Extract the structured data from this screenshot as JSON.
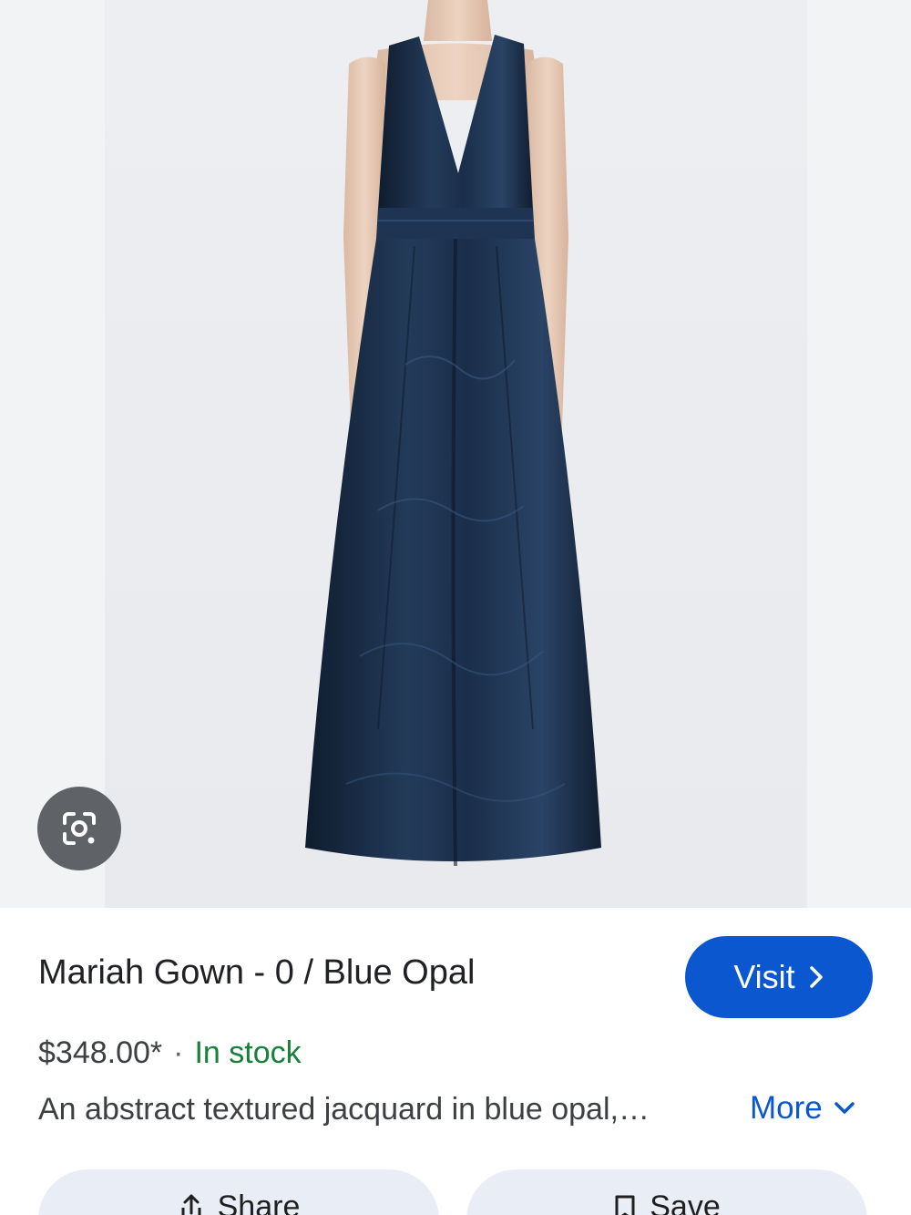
{
  "product": {
    "title": "Mariah Gown - 0 / Blue Opal",
    "price": "$348.00*",
    "separator": "·",
    "availability": "In stock",
    "description": "An abstract textured jacquard in blue opal,…"
  },
  "actions": {
    "visit_label": "Visit",
    "more_label": "More",
    "share_label": "Share",
    "save_label": "Save"
  },
  "icons": {
    "lens": "google-lens-icon",
    "visit_chevron": "chevron-right-icon",
    "more_chevron": "chevron-down-icon",
    "share": "share-icon",
    "save": "bookmark-icon"
  },
  "colors": {
    "accent": "#0b57d0",
    "in_stock": "#188038",
    "dress": "#1c2f48",
    "action_bg": "#e9eef6",
    "lens_bg": "#5f6368"
  }
}
